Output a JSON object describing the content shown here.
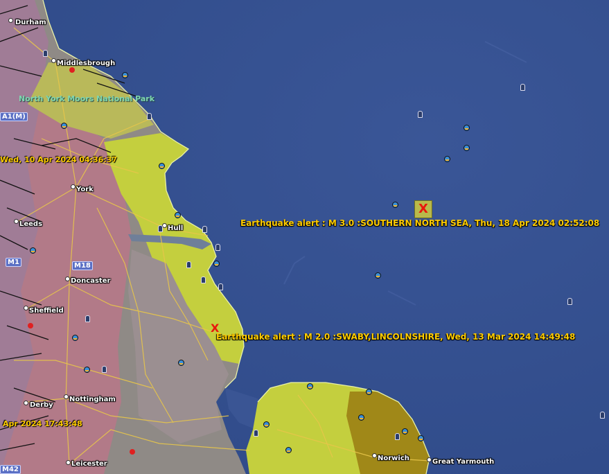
{
  "map": {
    "towns": [
      "Durham",
      "Middlesbrough",
      "York",
      "Leeds",
      "Hull",
      "Doncaster",
      "Sheffield",
      "Derby",
      "Nottingham",
      "Leicester",
      "Norwich",
      "Great Yarmouth"
    ],
    "park": "North York Moors National Park",
    "roads": [
      "A1(M)",
      "M1",
      "M18",
      "M42"
    ],
    "alerts": [
      "Earthquake alert : M  3.0 :SOUTHERN NORTH SEA, Thu, 18 Apr 2024 02:52:08",
      "Earthquake alert : M  2.0 :SWABY,LINCOLNSHIRE, Wed, 13 Mar 2024 14:49:48"
    ],
    "timestamps": [
      "Wed, 10 Apr 2024 04:36:37",
      "Apr 2024 17:43:48"
    ],
    "marker_symbol": "X",
    "colors": {
      "sea": "#35508f",
      "land_yellow": "#c4cf3e",
      "land_pink": "#b27a88",
      "land_grey": "#8f8a86",
      "land_brown": "#a08818",
      "alert_text": "#ffcc00",
      "quake_marker": "#e8170d"
    }
  }
}
